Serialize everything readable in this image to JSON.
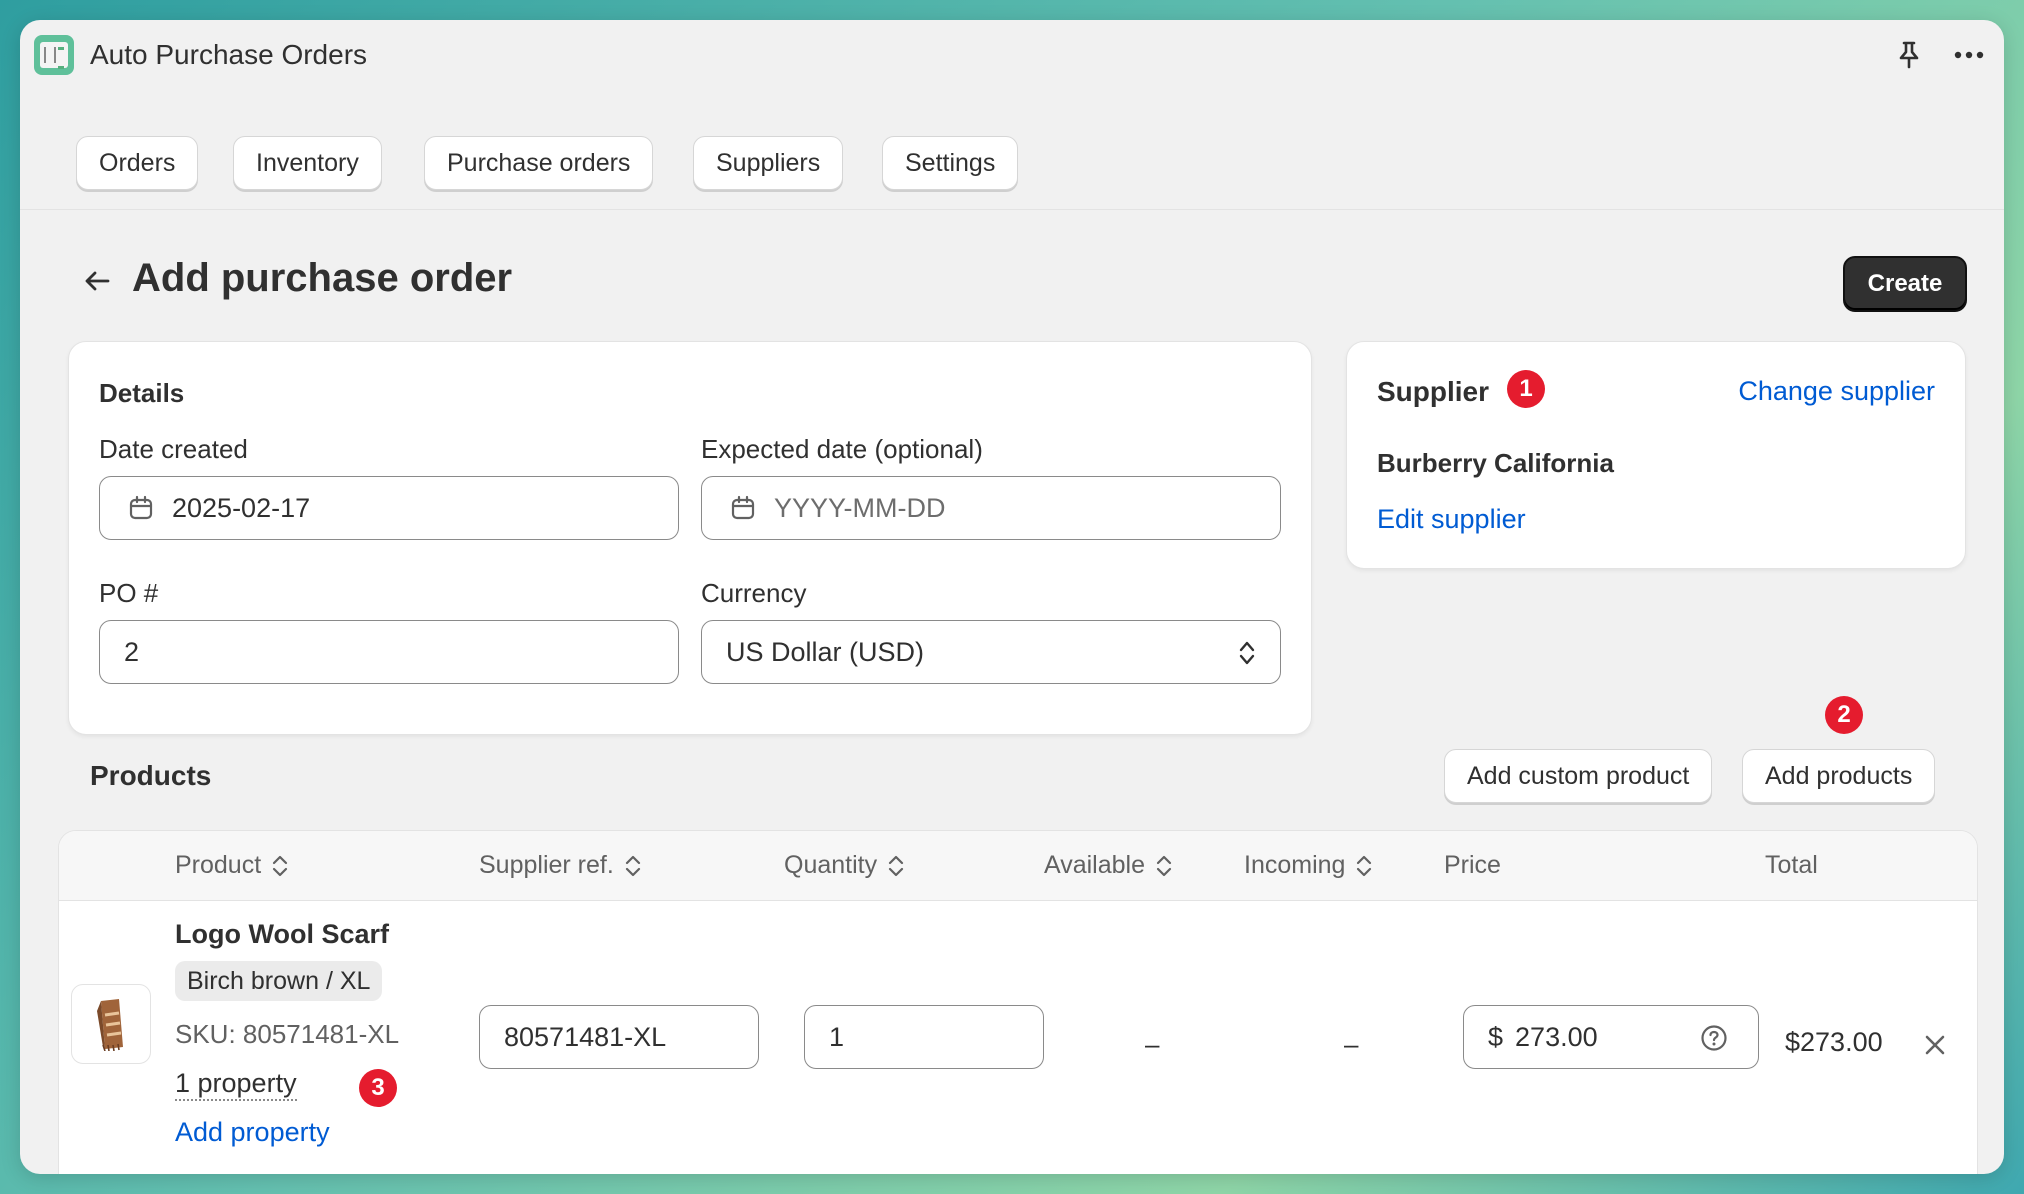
{
  "app": {
    "title": "Auto Purchase Orders",
    "icons": [
      "pin-icon",
      "more-horizontal-icon"
    ]
  },
  "nav": {
    "tabs": [
      {
        "label": "Orders"
      },
      {
        "label": "Inventory"
      },
      {
        "label": "Purchase orders"
      },
      {
        "label": "Suppliers"
      },
      {
        "label": "Settings"
      }
    ]
  },
  "page": {
    "title": "Add purchase order",
    "create_label": "Create"
  },
  "details": {
    "title": "Details",
    "date_created_label": "Date created",
    "date_created_value": "2025-02-17",
    "expected_date_label": "Expected date (optional)",
    "expected_date_placeholder": "YYYY-MM-DD",
    "po_label": "PO #",
    "po_value": "2",
    "currency_label": "Currency",
    "currency_value": "US Dollar (USD)"
  },
  "supplier": {
    "title": "Supplier",
    "badge": "1",
    "change_label": "Change supplier",
    "name": "Burberry California",
    "edit_label": "Edit supplier"
  },
  "products": {
    "title": "Products",
    "add_custom_label": "Add custom product",
    "add_products_label": "Add products",
    "add_products_badge": "2",
    "columns": {
      "product": "Product",
      "supplier_ref": "Supplier ref.",
      "quantity": "Quantity",
      "available": "Available",
      "incoming": "Incoming",
      "price": "Price",
      "total": "Total"
    },
    "rows": [
      {
        "name": "Logo Wool Scarf",
        "variant": "Birch brown / XL",
        "sku": "SKU: 80571481-XL",
        "property": "1 property",
        "property_badge": "3",
        "add_property_label": "Add property",
        "supplier_ref": "80571481-XL",
        "quantity": "1",
        "available": "–",
        "incoming": "–",
        "currency_symbol": "$",
        "price": "273.00",
        "total": "$273.00"
      }
    ]
  },
  "colors": {
    "accent_link": "#005bd3",
    "badge": "#e51c2e",
    "primary_button": "#303030"
  }
}
